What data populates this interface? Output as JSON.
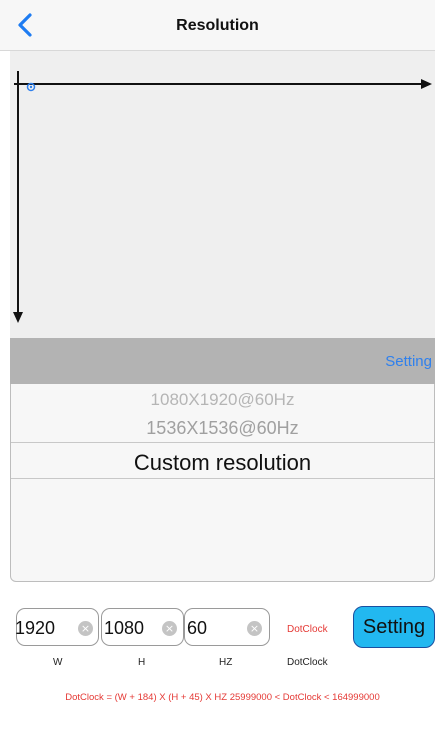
{
  "nav": {
    "title": "Resolution",
    "back_icon": "chevron-left-icon",
    "accent": "#1e7cf2"
  },
  "toolbar": {
    "setting_label": "Setting"
  },
  "picker": {
    "options": [
      "1080X1920@60Hz",
      "1536X1536@60Hz",
      "Custom resolution"
    ],
    "selected": "Custom resolution"
  },
  "inputs": {
    "width": {
      "value": "1920",
      "label": "W"
    },
    "height": {
      "value": "1080",
      "label": "H"
    },
    "hz": {
      "value": "60",
      "label": "HZ"
    },
    "dotclock_value": "DotClock",
    "dotclock_label": "DotClock",
    "clear_icon": "clear-circle-icon"
  },
  "action": {
    "setting_label": "Setting",
    "color": "#22b8f0"
  },
  "formula": "DotClock = (W + 184) X (H + 45) X HZ   25999000 < DotClock < 164999000"
}
